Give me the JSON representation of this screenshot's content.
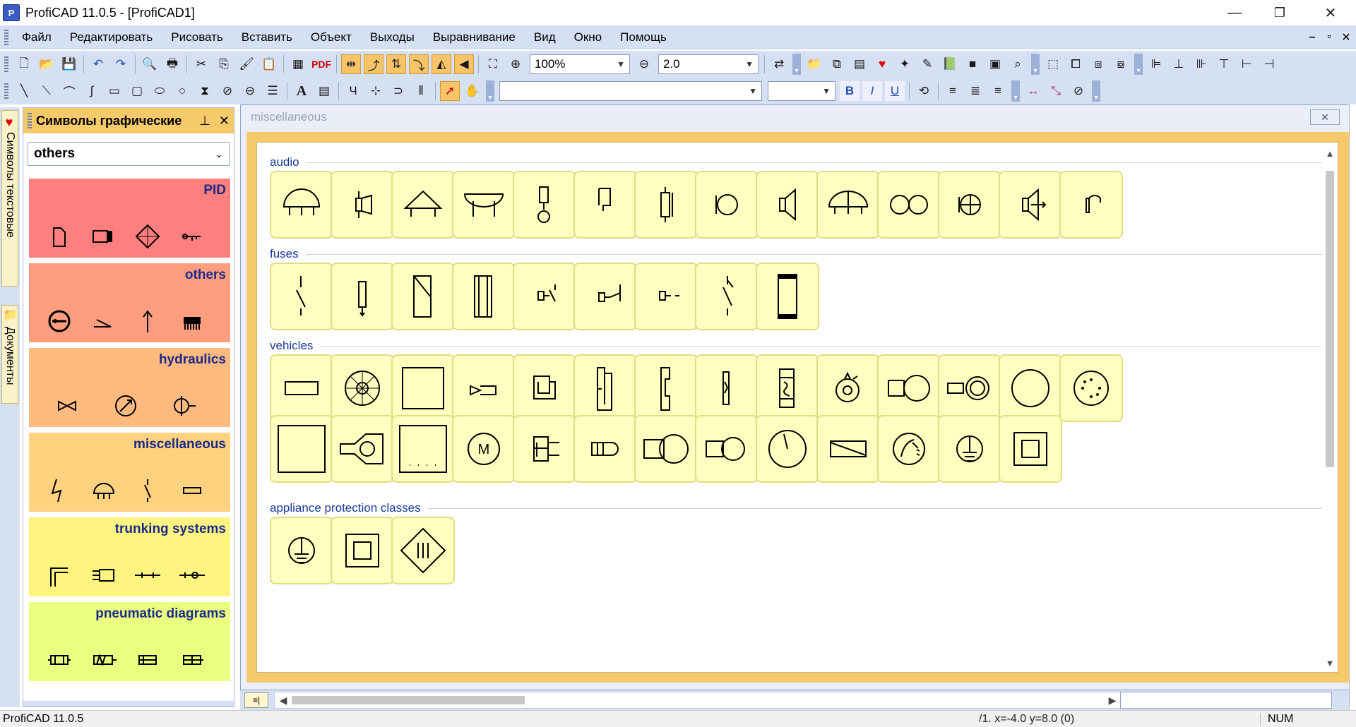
{
  "window": {
    "title": "ProfiCAD 11.0.5 - [ProfiCAD1]",
    "controls": {
      "minimize": "—",
      "restore": "❐",
      "close": "✕"
    }
  },
  "menu": {
    "items": [
      "Файл",
      "Редактировать",
      "Рисовать",
      "Вставить",
      "Объект",
      "Выходы",
      "Выравнивание",
      "Вид",
      "Окно",
      "Помощь"
    ],
    "mdi_controls": {
      "minimize": "–",
      "restore": "▫",
      "close": "✕"
    }
  },
  "toolbar": {
    "zoom_value": "100%",
    "line_width_value": "2.0",
    "pdf_label": "PDF",
    "font_combo_value": "",
    "size_combo_value": "",
    "bold_label": "B",
    "italic_label": "I",
    "underline_label": "U",
    "text_tool_label": "A"
  },
  "vtabs": {
    "symbols_text": "Символы текстовые",
    "documents": "Документы"
  },
  "panel": {
    "title": "Символы графические",
    "pin": "📌",
    "close": "✕",
    "selected_collection": "others",
    "categories": [
      {
        "label": "PID",
        "color": "#ff7f7f"
      },
      {
        "label": "others",
        "color": "#ff9e7f"
      },
      {
        "label": "hydraulics",
        "color": "#ffba7f"
      },
      {
        "label": "miscellaneous",
        "color": "#ffd27f"
      },
      {
        "label": "trunking systems",
        "color": "#fff47f"
      },
      {
        "label": "pneumatic diagrams",
        "color": "#eaff7f"
      }
    ]
  },
  "document": {
    "title": "miscellaneous",
    "close_label": "✕",
    "sections": [
      {
        "label": "audio",
        "count": 14
      },
      {
        "label": "fuses",
        "count": 9
      },
      {
        "label": "vehicles",
        "count": 27
      },
      {
        "label": "appliance protection classes",
        "count": 3
      }
    ],
    "layer_label": "≡|"
  },
  "colors": {
    "chrome": "#d6e0f3",
    "panel_header": "#f6c96b",
    "cell_fill": "#ffffc0",
    "cell_border": "#e0dc84",
    "section_label": "#1a3a9a"
  },
  "status": {
    "left": "ProfiCAD 11.0.5",
    "coords": "/1.  x=-4.0  y=8.0 (0)",
    "num": "NUM"
  }
}
